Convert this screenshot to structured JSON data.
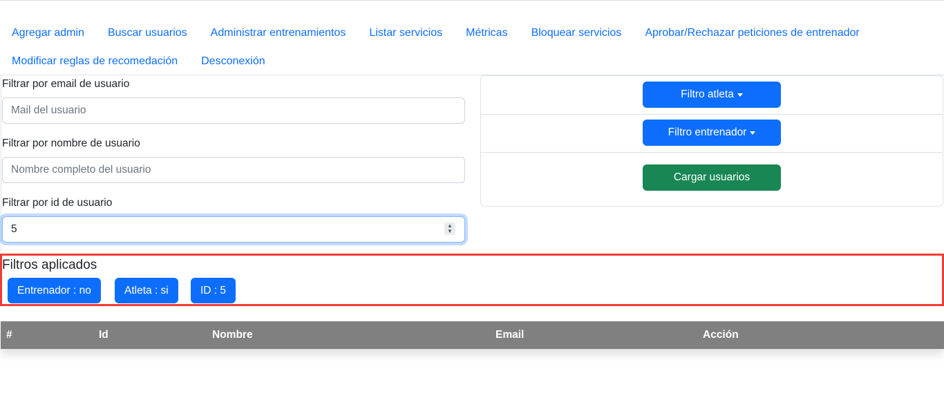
{
  "nav": {
    "row1": [
      "Agregar admin",
      "Buscar usuarios",
      "Administrar entrenamientos",
      "Listar servicios",
      "Métricas",
      "Bloquear servicios",
      "Aprobar/Rechazar peticiones de entrenador"
    ],
    "row2": [
      "Modificar reglas de recomedación",
      "Desconexión"
    ]
  },
  "filters": {
    "email_label": "Filtrar por email de usuario",
    "email_placeholder": "Mail del usuario",
    "email_value": "",
    "name_label": "Filtrar por nombre de usuario",
    "name_placeholder": "Nombre completo del usuario",
    "name_value": "",
    "id_label": "Filtrar por id de usuario",
    "id_value": "5"
  },
  "card": {
    "athlete_filter_label": "Filtro atleta",
    "trainer_filter_label": "Filtro entrenador",
    "load_users_label": "Cargar usuarios"
  },
  "applied": {
    "title": "Filtros aplicados",
    "chips": [
      "Entrenador : no",
      "Atleta : si",
      "ID : 5"
    ]
  },
  "table": {
    "columns": [
      "#",
      "Id",
      "Nombre",
      "Email",
      "Acción"
    ]
  },
  "colors": {
    "primary": "#0d6efd",
    "success": "#198754",
    "header_gray": "#808080",
    "highlight_red": "#ef3b36"
  }
}
